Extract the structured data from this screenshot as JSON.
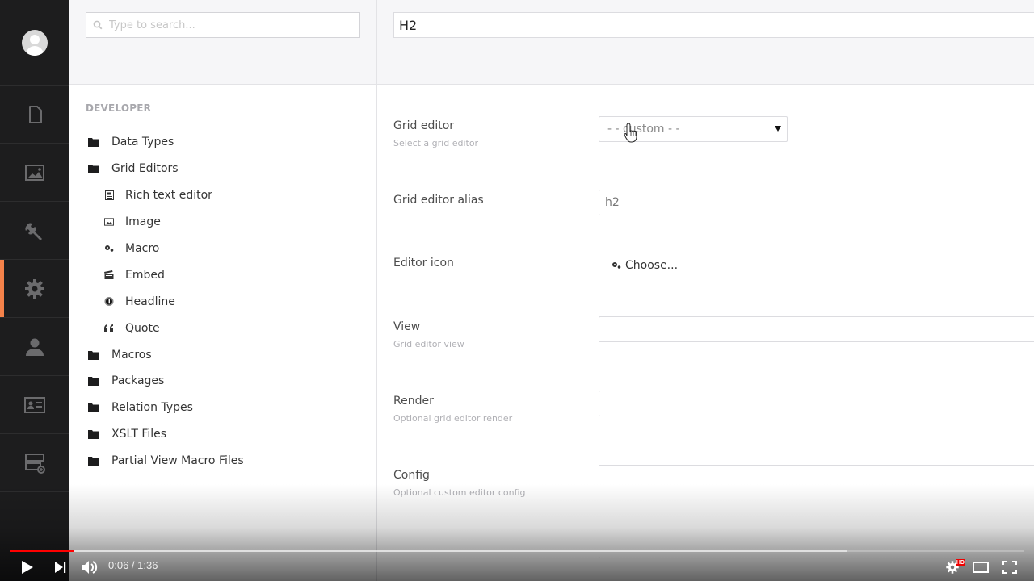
{
  "app_nav": {
    "items": [
      {
        "name": "content",
        "icon": "document-icon"
      },
      {
        "name": "media",
        "icon": "image-icon"
      },
      {
        "name": "settings",
        "icon": "wrench-icon"
      },
      {
        "name": "developer",
        "icon": "gear-icon",
        "active": true
      },
      {
        "name": "users",
        "icon": "user-icon"
      },
      {
        "name": "members",
        "icon": "id-card-icon"
      },
      {
        "name": "forms",
        "icon": "form-add-icon"
      }
    ],
    "accent_color": "#f5824a"
  },
  "tree": {
    "search_placeholder": "Type to search...",
    "section_title": "DEVELOPER",
    "items": [
      {
        "label": "Data Types",
        "icon": "folder-icon",
        "level": 0
      },
      {
        "label": "Grid Editors",
        "icon": "folder-icon",
        "level": 0
      },
      {
        "label": "Rich text editor",
        "icon": "rich-text-icon",
        "level": 1
      },
      {
        "label": "Image",
        "icon": "image-icon",
        "level": 1
      },
      {
        "label": "Macro",
        "icon": "settings-alt-icon",
        "level": 1
      },
      {
        "label": "Embed",
        "icon": "movie-icon",
        "level": 1
      },
      {
        "label": "Headline",
        "icon": "headline-icon",
        "level": 1
      },
      {
        "label": "Quote",
        "icon": "quote-icon",
        "level": 1
      },
      {
        "label": "Macros",
        "icon": "folder-icon",
        "level": 0
      },
      {
        "label": "Packages",
        "icon": "folder-icon",
        "level": 0
      },
      {
        "label": "Relation Types",
        "icon": "folder-icon",
        "level": 0
      },
      {
        "label": "XSLT Files",
        "icon": "folder-icon",
        "level": 0
      },
      {
        "label": "Partial View Macro Files",
        "icon": "folder-icon",
        "level": 0
      }
    ]
  },
  "editor": {
    "name_value": "H2",
    "fields": {
      "grid_editor": {
        "label": "Grid editor",
        "description": "Select a grid editor",
        "selected": "- - custom - -"
      },
      "alias": {
        "label": "Grid editor alias",
        "value": "h2"
      },
      "icon": {
        "label": "Editor icon",
        "choose_label": "Choose..."
      },
      "view": {
        "label": "View",
        "description": "Grid editor view",
        "value": ""
      },
      "render": {
        "label": "Render",
        "description": "Optional grid editor render",
        "value": ""
      },
      "config": {
        "label": "Config",
        "description": "Optional custom editor config",
        "value": ""
      }
    }
  },
  "player": {
    "current_time": "0:06",
    "duration": "1:36",
    "time_display": "0:06 / 1:36",
    "played_fraction": 0.0625,
    "buffered_fraction": 0.826,
    "hd_badge": "HD",
    "progress_color": "#ff0000"
  }
}
